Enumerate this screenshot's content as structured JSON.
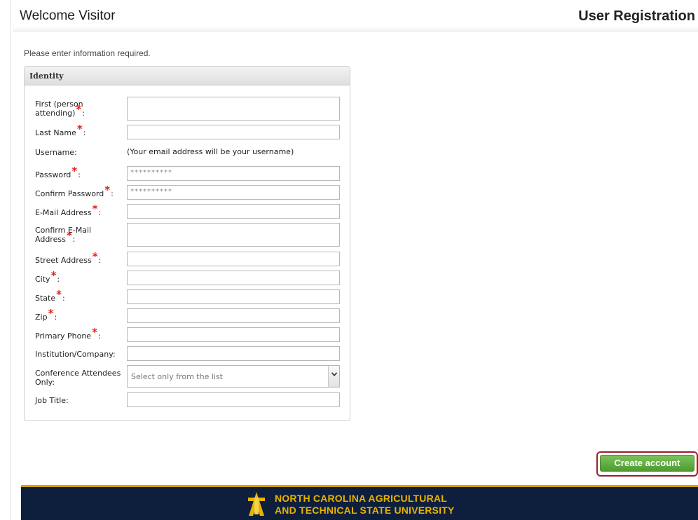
{
  "header": {
    "welcome": "Welcome Visitor",
    "title": "User Registration"
  },
  "instructions": "Please enter information required.",
  "panel": {
    "title": "Identity"
  },
  "fields": {
    "first_name": {
      "label": "First (person attending)",
      "value": ""
    },
    "last_name": {
      "label": "Last Name",
      "value": ""
    },
    "username": {
      "label": "Username:",
      "note": "(Your email address will be your username)"
    },
    "password": {
      "label": "Password",
      "value": "**********"
    },
    "confirm_password": {
      "label": "Confirm Password",
      "value": "**********"
    },
    "email": {
      "label": "E-Mail Address",
      "value": ""
    },
    "confirm_email": {
      "label": "Confirm E-Mail Address",
      "value": ""
    },
    "street": {
      "label": "Street Address",
      "value": ""
    },
    "city": {
      "label": "City",
      "value": ""
    },
    "state": {
      "label": "State",
      "value": ""
    },
    "zip": {
      "label": "Zip",
      "value": ""
    },
    "phone": {
      "label": "Primary Phone",
      "value": ""
    },
    "institution": {
      "label": "Institution/Company:",
      "value": ""
    },
    "conference": {
      "label": "Conference Attendees Only:",
      "selected": "Select only from the list"
    },
    "job_title": {
      "label": "Job Title:",
      "value": ""
    }
  },
  "required_marker": "*",
  "label_colon": ":",
  "actions": {
    "create_account": "Create account"
  },
  "footer": {
    "line1": "NORTH CAROLINA AGRICULTURAL",
    "line2": "AND TECHNICAL STATE UNIVERSITY"
  },
  "colors": {
    "accent_green": "#5aa63a",
    "required_red": "#e0201c",
    "footer_navy": "#0e1f3d",
    "footer_gold": "#e8b400",
    "highlight_maroon": "#9c1e2a"
  },
  "icons": {
    "select_arrow": "chevron-down-icon",
    "university_logo": "aggie-logo-icon"
  }
}
